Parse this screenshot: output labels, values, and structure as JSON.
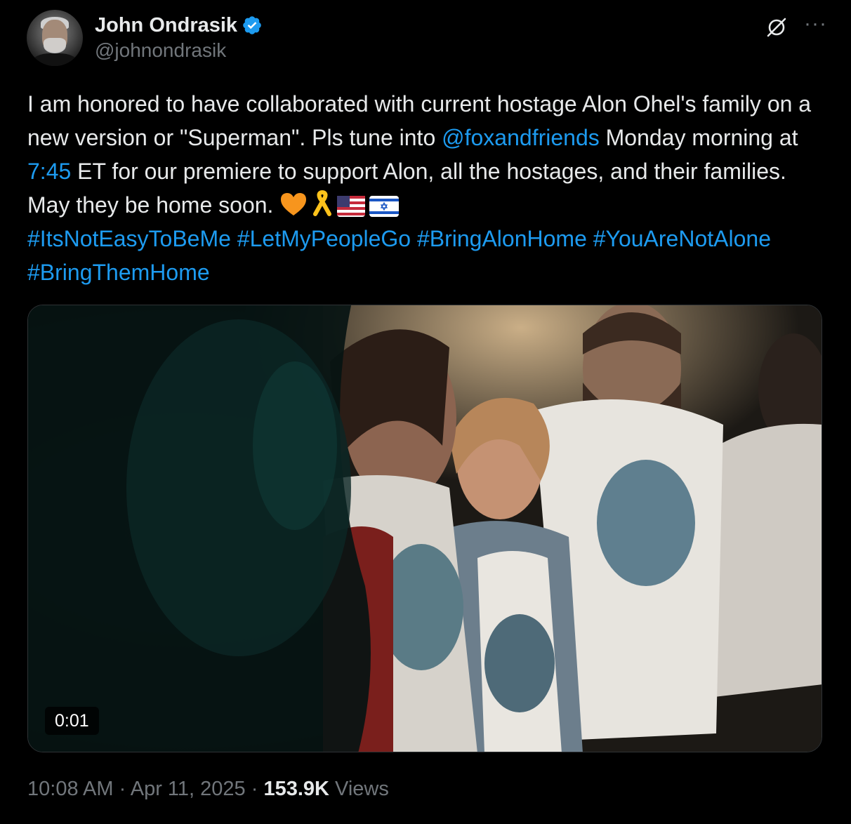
{
  "author": {
    "display_name": "John Ondrasik",
    "handle": "@johnondrasik",
    "verified": true,
    "avatar_icon": "profile-photo"
  },
  "actions": {
    "grok_icon": "grok-icon",
    "more": "···"
  },
  "tweet": {
    "text_1": "I am honored to have collaborated with current hostage Alon Ohel's family on a new version or \"Superman\". Pls tune into ",
    "mention": "@foxandfriends",
    "text_2": " Monday morning at ",
    "time_link": "7:45",
    "text_3": " ET for our premiere to support Alon, all the hostages, and their families. May they be home soon. ",
    "emojis": [
      "orange-heart",
      "yellow-ribbon",
      "us-flag",
      "israel-flag"
    ],
    "hashtags": [
      "#ItsNotEasyToBeMe",
      "#LetMyPeopleGo",
      "#BringAlonHome",
      "#YouAreNotAlone",
      "#BringThemHome"
    ]
  },
  "media": {
    "type": "video",
    "duration": "0:01"
  },
  "meta": {
    "time": "10:08 AM",
    "date": "Apr 11, 2025",
    "separator": "·",
    "views_count": "153.9K",
    "views_label": "Views"
  },
  "colors": {
    "background": "#000000",
    "text": "#e7e9ea",
    "secondary": "#71767b",
    "link": "#1d9bf0",
    "verified": "#1d9bf0",
    "border": "#2f3336"
  }
}
